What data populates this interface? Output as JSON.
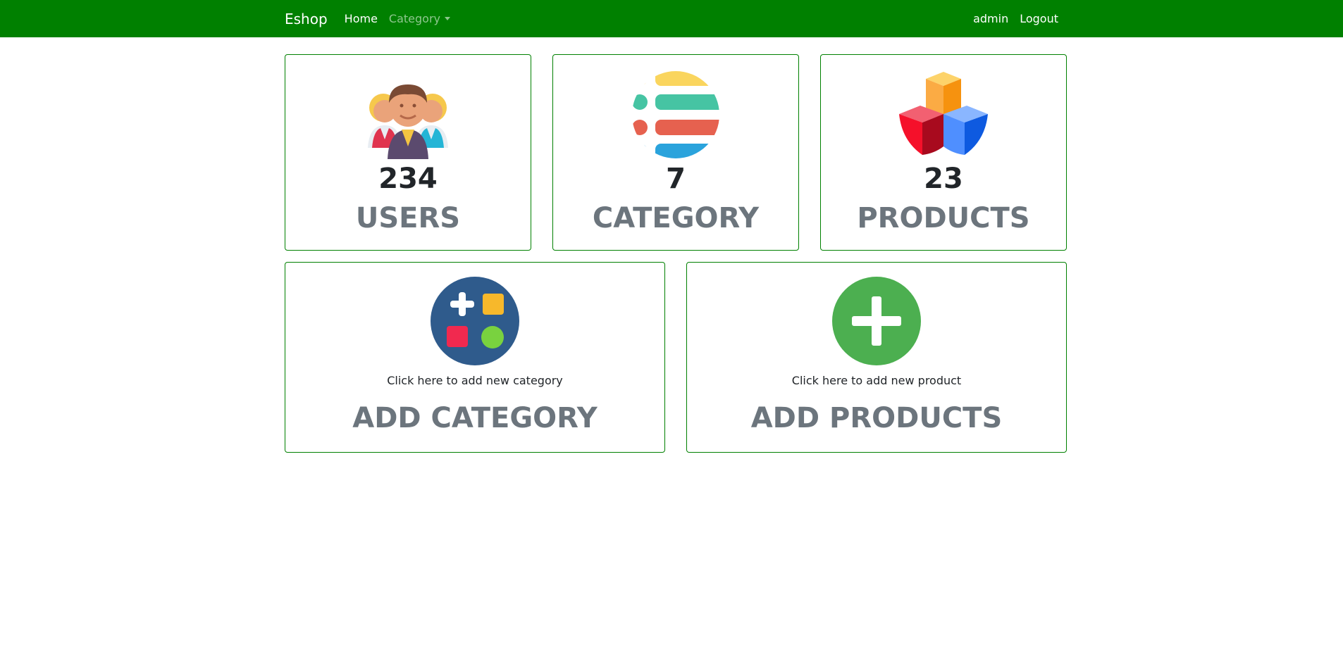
{
  "nav": {
    "brand": "Eshop",
    "home": "Home",
    "category": "Category",
    "user": "admin",
    "logout": "Logout"
  },
  "stats": [
    {
      "count": "234",
      "label": "USERS",
      "icon": "users-icon"
    },
    {
      "count": "7",
      "label": "CATEGORY",
      "icon": "category-list-icon"
    },
    {
      "count": "23",
      "label": "PRODUCTS",
      "icon": "products-cubes-icon"
    }
  ],
  "actions": [
    {
      "hint": "Click here to add new category",
      "label": "ADD CATEGORY",
      "icon": "add-category-icon"
    },
    {
      "hint": "Click here to add new product",
      "label": "ADD PRODUCTS",
      "icon": "add-product-icon"
    }
  ],
  "colors": {
    "navbar": "#008000",
    "card_border": "#008000",
    "label_gray": "#6c757d"
  }
}
